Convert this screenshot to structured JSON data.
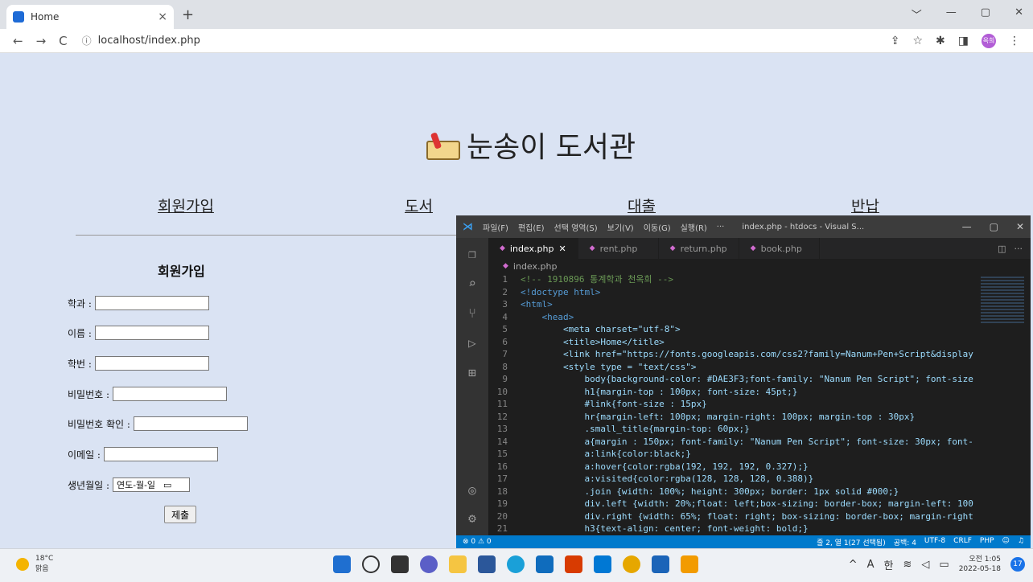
{
  "browser": {
    "tab_title": "Home",
    "tab_close": "×",
    "new_tab": "+",
    "url": "localhost/index.php",
    "window_controls": [
      "﹀",
      "—",
      "▢",
      "✕"
    ],
    "profile_initials": "옥희"
  },
  "page": {
    "title": "눈송이 도서관",
    "nav": [
      "회원가입",
      "도서",
      "대출",
      "반납"
    ],
    "join_title": "회원가입",
    "fields": [
      {
        "label": "학과 :"
      },
      {
        "label": "이름 :"
      },
      {
        "label": "학번 :"
      },
      {
        "label": "비밀번호 :"
      },
      {
        "label": "비밀번호 확인 :"
      },
      {
        "label": "이메일 :"
      }
    ],
    "birth_label": "생년월일 :",
    "birth_placeholder": "연도-월-일",
    "submit_label": "제출"
  },
  "vscode": {
    "menu": [
      "파일(F)",
      "편집(E)",
      "선택 영역(S)",
      "보기(V)",
      "이동(G)",
      "실행(R)",
      "···"
    ],
    "window_title": "index.php - htdocs - Visual S...",
    "tabs": [
      "index.php",
      "rent.php",
      "return.php",
      "book.php"
    ],
    "breadcrumb": "index.php",
    "code_lines": [
      "<!-- 1910896 통계학과 천옥희 -->",
      "<!doctype html>",
      "<html>",
      "    <head>",
      "        <meta charset=\"utf-8\">",
      "        <title>Home</title>",
      "        <link href=\"https://fonts.googleapis.com/css2?family=Nanum+Pen+Script&display",
      "        <style type = \"text/css\">",
      "            body{background-color: #DAE3F3;font-family: \"Nanum Pen Script\"; font-size",
      "            h1{margin-top : 100px; font-size: 45pt;}",
      "            #link{font-size : 15px}",
      "            hr{margin-left: 100px; margin-right: 100px; margin-top : 30px}",
      "            .small_title{margin-top: 60px;}",
      "            a{margin : 150px; font-family: \"Nanum Pen Script\"; font-size: 30px; font-",
      "            a:link{color:black;}",
      "            a:hover{color:rgba(192, 192, 192, 0.327);}",
      "            a:visited{color:rgba(128, 128, 128, 0.388)}",
      "            .join {width: 100%; height: 300px; border: 1px solid #000;}",
      "            div.left {width: 20%;float: left;box-sizing: border-box; margin-left: 100",
      "            div.right {width: 65%; float: right; box-sizing: border-box; margin-right",
      "            h3{text-align: center; font-weight: bold;}"
    ],
    "status_left": "⊗ 0 ⚠ 0",
    "status_right": [
      "줄 2, 열 1(27 선택됨)",
      "공백: 4",
      "UTF-8",
      "CRLF",
      "PHP"
    ]
  },
  "taskbar": {
    "temperature": "18°C",
    "weather": "맑음",
    "ime_a": "A",
    "ime_han": "한",
    "time": "오전 1:05",
    "date": "2022-05-18",
    "notifications": "17"
  }
}
